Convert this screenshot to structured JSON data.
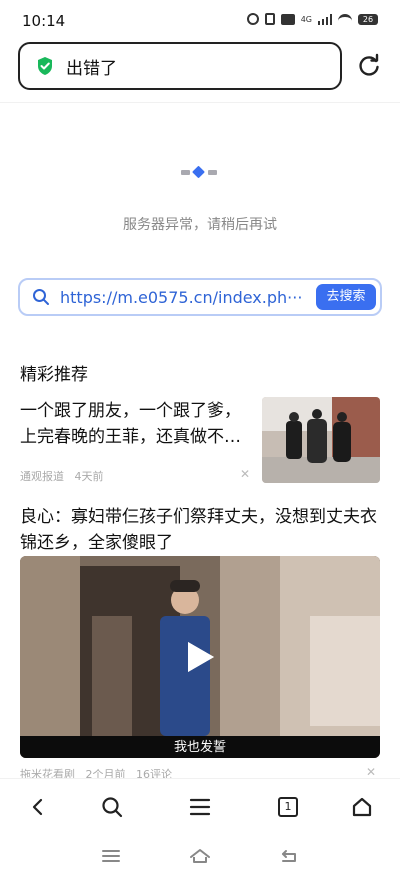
{
  "status_bar": {
    "time": "10:14",
    "network": "4G",
    "battery": "26"
  },
  "address_bar": {
    "title": "出错了"
  },
  "error": {
    "message": "服务器异常，请稍后再试"
  },
  "search": {
    "url": "https://m.e0575.cn/index.ph···",
    "button_label": "去搜索"
  },
  "recommend": {
    "title": "精彩推荐",
    "articles": [
      {
        "title": "一个跟了朋友，一个跟了爹，上完春晚的王菲，还真做不…",
        "source": "通观报道",
        "time": "4天前"
      },
      {
        "title": "良心：寡妇带仨孩子们祭拜丈夫，没想到丈夫衣锦还乡，全家傻眼了",
        "video_caption": "我也发誓",
        "source": "拖米花看剧",
        "time": "2个月前",
        "comments": "16评论"
      }
    ]
  },
  "toolbar": {
    "tab_count": "1"
  },
  "colors": {
    "accent": "#3a6ff0",
    "url_text": "#2f64d6",
    "shield_green": "#19b85b"
  }
}
